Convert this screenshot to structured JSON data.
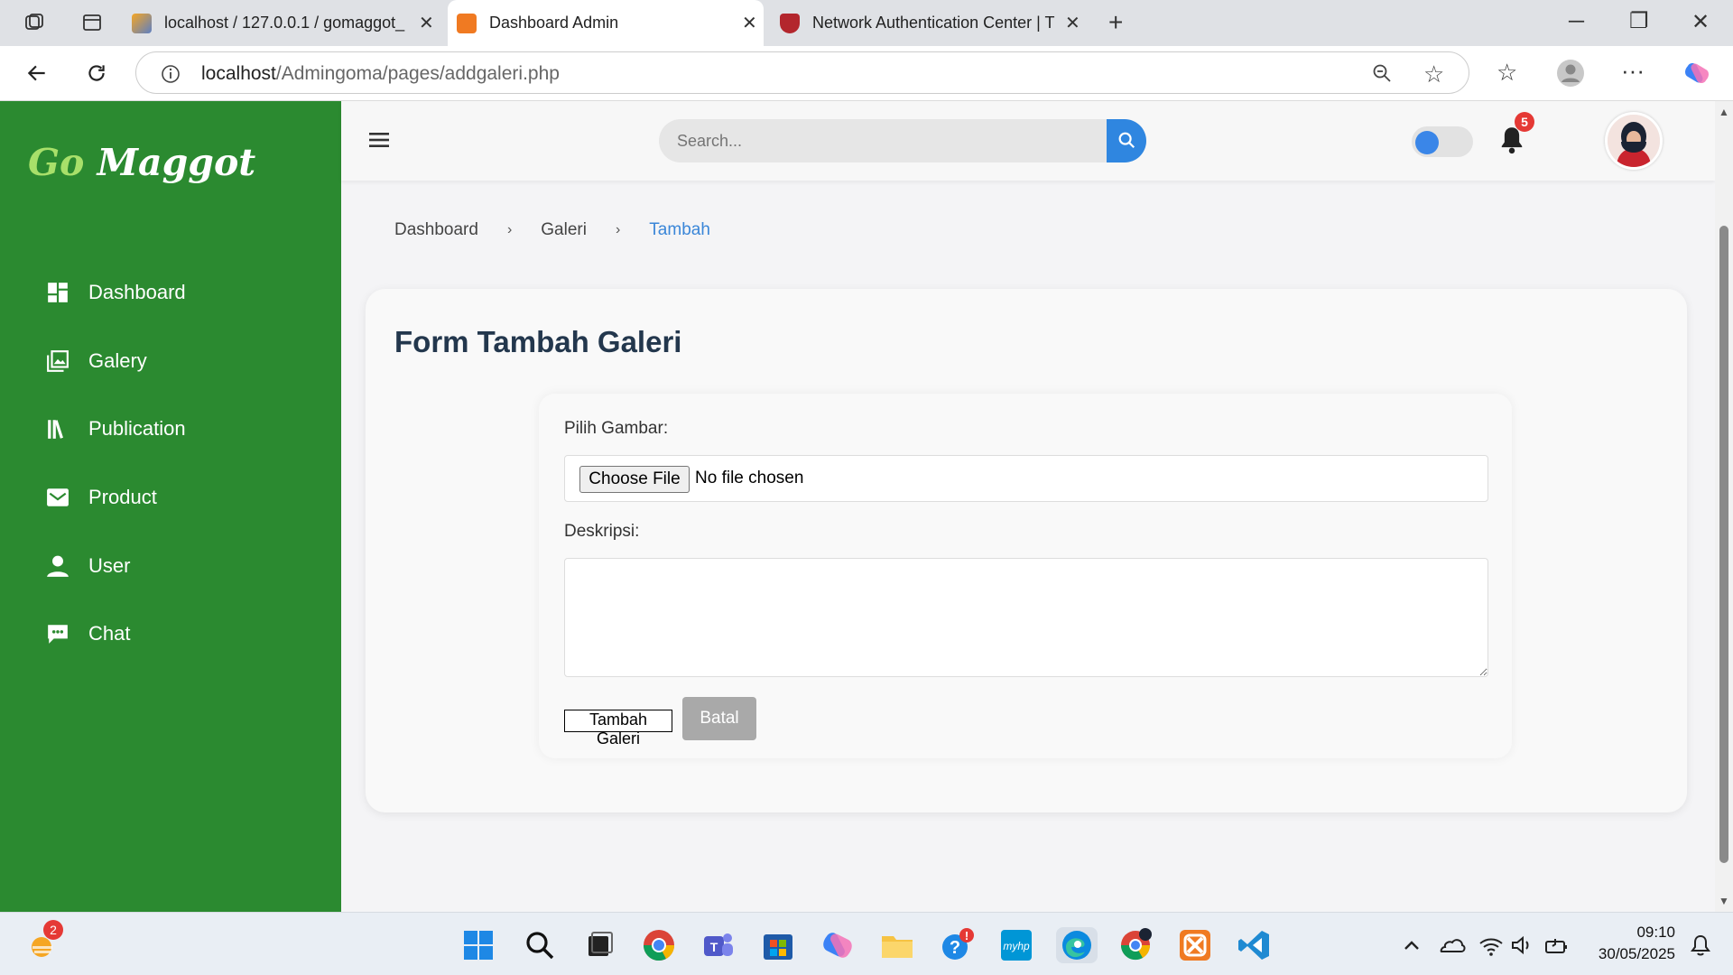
{
  "browser": {
    "tabs": [
      {
        "title": "localhost / 127.0.0.1 / gomaggot_"
      },
      {
        "title": "Dashboard Admin"
      },
      {
        "title": "Network Authentication Center | T"
      }
    ],
    "url_host": "localhost",
    "url_path": "/Admingoma/pages/addgaleri.php"
  },
  "sidebar": {
    "logo_go": "Go",
    "logo_maggot": "Maggot",
    "items": [
      {
        "label": "Dashboard",
        "icon": "dashboard-grid-icon"
      },
      {
        "label": "Galery",
        "icon": "gallery-icon"
      },
      {
        "label": "Publication",
        "icon": "library-books-icon"
      },
      {
        "label": "Product",
        "icon": "envelope-icon"
      },
      {
        "label": "User",
        "icon": "user-icon"
      },
      {
        "label": "Chat",
        "icon": "chat-bubble-icon"
      }
    ]
  },
  "header": {
    "search_placeholder": "Search...",
    "notification_count": "5"
  },
  "breadcrumb": [
    "Dashboard",
    "Galeri",
    "Tambah"
  ],
  "form": {
    "title": "Form Tambah Galeri",
    "image_label": "Pilih Gambar:",
    "choose_file_label": "Choose File",
    "no_file_text": "No file chosen",
    "description_label": "Deskripsi:",
    "description_value": "",
    "submit_label": "Tambah Galeri",
    "cancel_label": "Batal"
  },
  "taskbar": {
    "time": "09:10",
    "date": "30/05/2025",
    "weather_badge": "2"
  },
  "colors": {
    "sidebar": "#2b8a30",
    "accent": "#2f86e0",
    "badge": "#e53935",
    "title": "#23374d"
  }
}
